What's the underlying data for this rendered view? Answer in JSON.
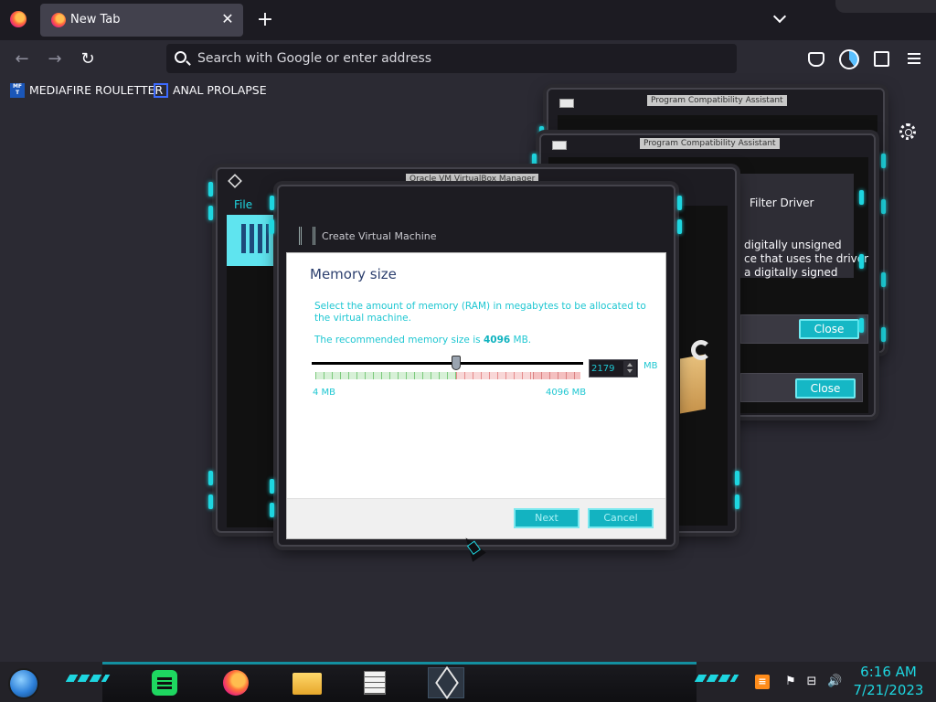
{
  "browser": {
    "tab_title": "New Tab",
    "tab_close_glyph": "✕",
    "new_tab_glyph": "+",
    "back_glyph": "←",
    "forward_glyph": "→",
    "reload_glyph": "↻",
    "url_placeholder": "Search with Google or enter address",
    "bookmarks": [
      {
        "icon_text": "MF T",
        "label": "MEDIAFIRE ROULETTER"
      },
      {
        "icon_text": "",
        "label": "ANAL PROLAPSE"
      }
    ]
  },
  "background_windows": {
    "pca_title": "Program Compatibility Assistant",
    "pca_text_1": "Filter Driver",
    "pca_text_2": "digitally unsigned",
    "pca_text_3": "ce that uses the driver",
    "pca_text_4": "a digitally signed",
    "close_label": "Close",
    "manager_title": "Oracle VM VirtualBox Manager",
    "manager_menu_file": "File"
  },
  "wizard": {
    "title": "Create Virtual Machine",
    "heading": "Memory size",
    "description": "Select the amount of memory (RAM) in megabytes to be allocated to the virtual machine.",
    "recommended_prefix": "The recommended memory size is ",
    "recommended_value": "4096",
    "recommended_suffix": " MB.",
    "memory_value": "2179",
    "memory_unit": "MB",
    "min_label": "4 MB",
    "max_label": "4096 MB",
    "slider_fraction": 0.532,
    "next_label": "Next",
    "cancel_label": "Cancel"
  },
  "taskbar": {
    "tray_ms_glyph": "≡",
    "tray_flag_glyph": "⚑",
    "tray_net_glyph": "⊟",
    "tray_volume_glyph": "🔊",
    "time": "6:16 AM",
    "date": "7/21/2023"
  },
  "icons": [
    "firefox-icon",
    "close-icon",
    "plus-icon",
    "chevron-down-icon",
    "back-arrow-icon",
    "forward-arrow-icon",
    "reload-icon",
    "search-icon",
    "pocket-icon",
    "account-icon",
    "extensions-icon",
    "hamburger-menu-icon",
    "settings-gear-icon",
    "virtualbox-icon",
    "toolbox-icon",
    "spotify-icon",
    "file-explorer-icon",
    "notepad-icon",
    "flag-icon",
    "network-icon",
    "volume-icon"
  ],
  "colors": {
    "accent": "#1ed6e0",
    "button": "#13b3c1",
    "heading": "#2c3f6e"
  }
}
